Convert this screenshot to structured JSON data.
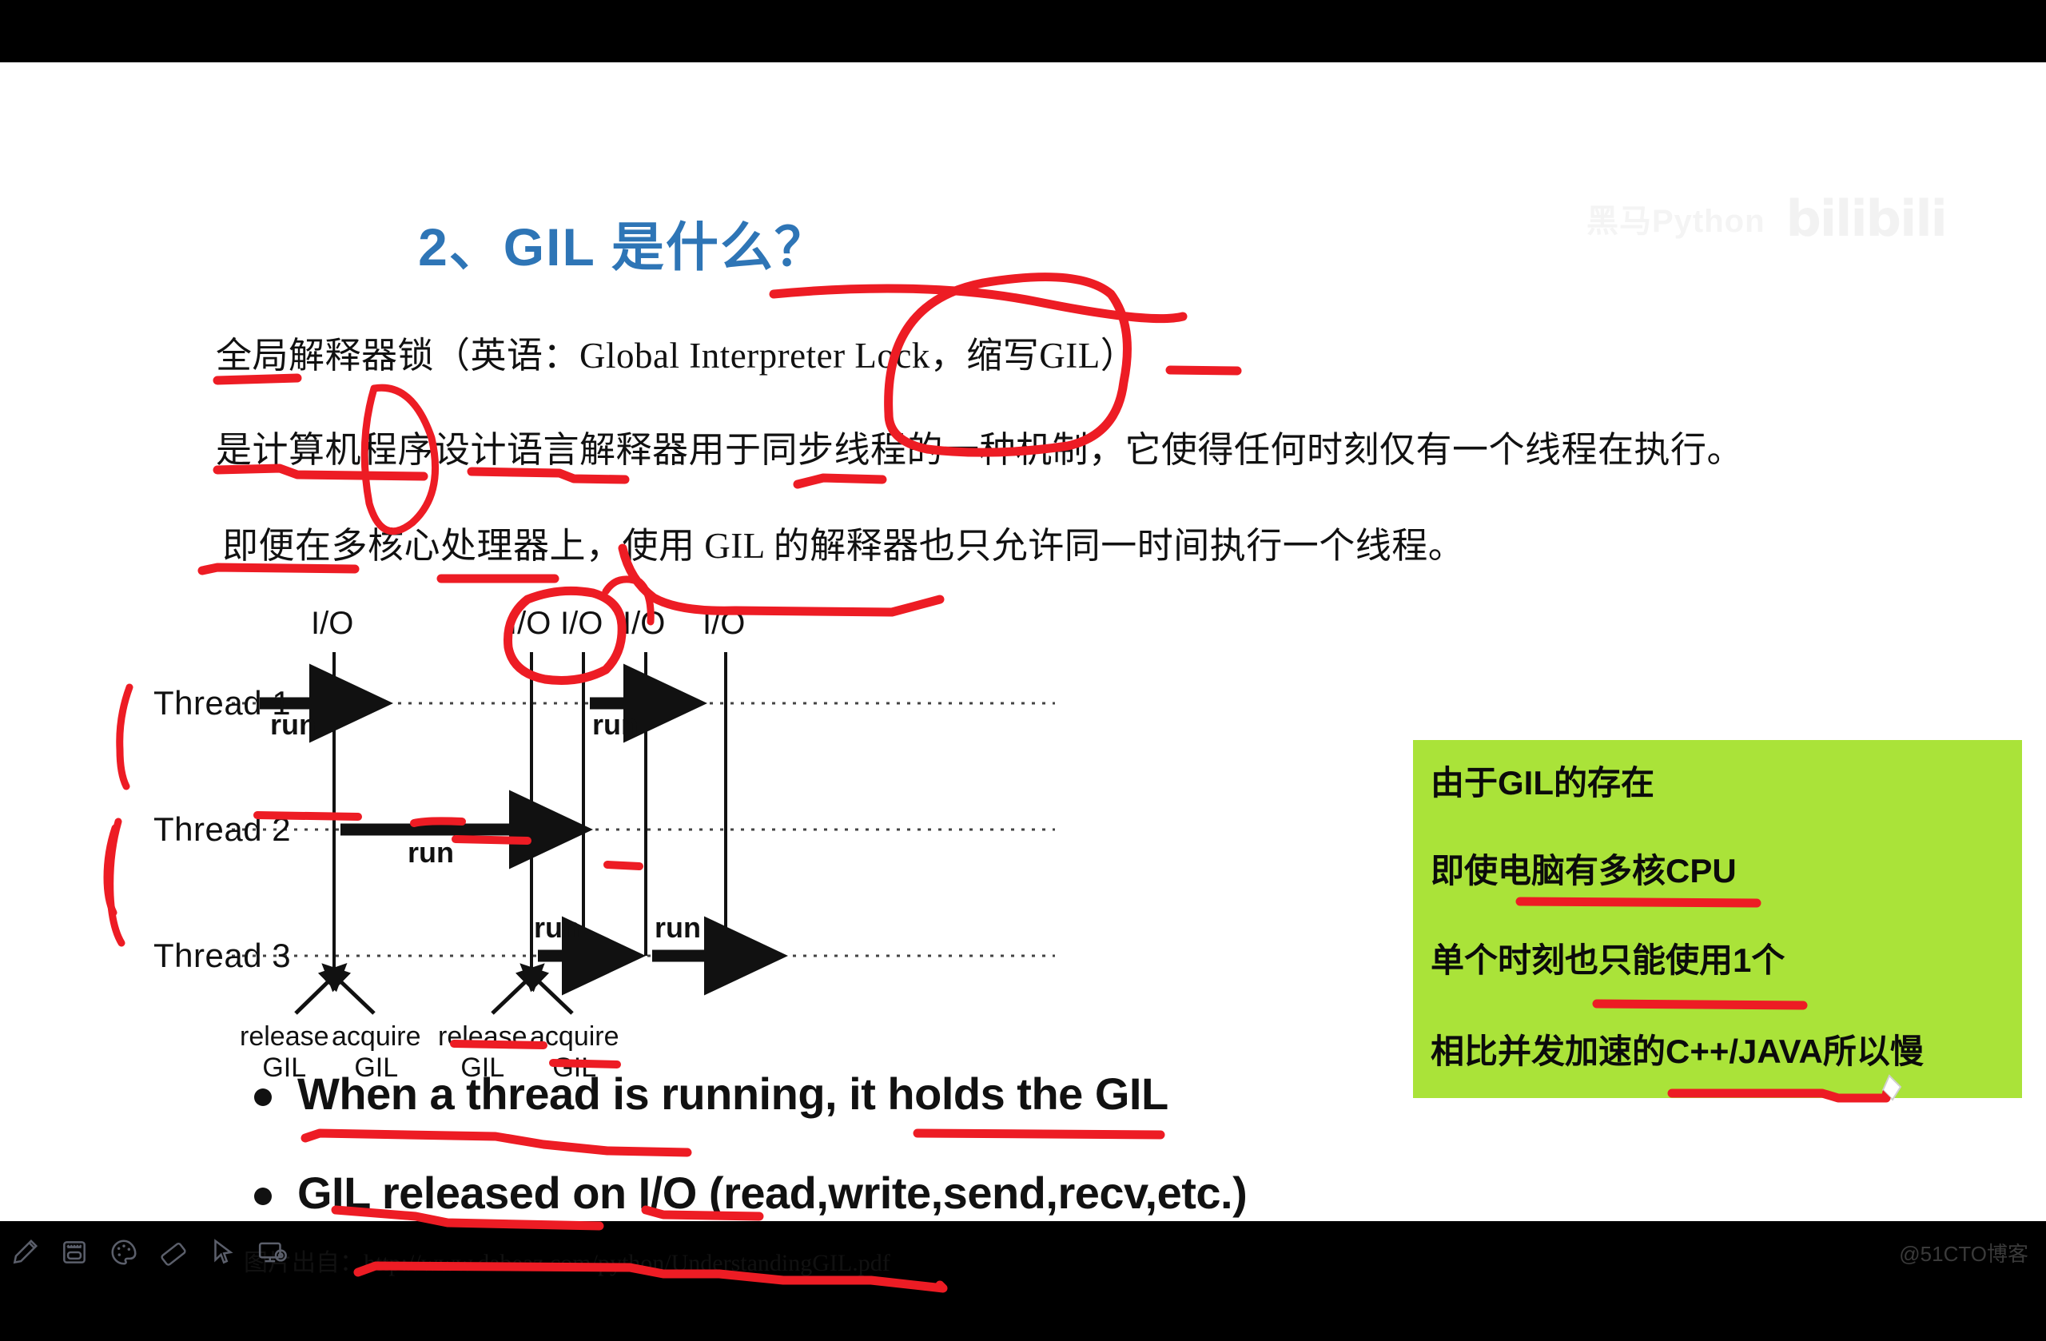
{
  "slide": {
    "title": "2、GIL 是什么？",
    "title_color": "#2E75B6",
    "paragraphs": [
      "全局解释器锁（英语：Global Interpreter Lock，缩写GIL）",
      "是计算机程序设计语言解释器用于同步线程的一种机制，它使得任何时刻仅有一个线程在执行。",
      "即便在多核心处理器上，使用 GIL 的解释器也只允许同一时间执行一个线程。"
    ],
    "bullets": [
      "When a thread is running, it holds the GIL",
      "GIL released on I/O (read,write,send,recv,etc.)"
    ],
    "source_line": "图片出自：http://www.dabeaz.com/python/UnderstandingGIL.pdf"
  },
  "diagram": {
    "thread_labels": [
      "Thread 1",
      "Thread 2",
      "Thread 3"
    ],
    "io_labels": [
      "I/O",
      "I/O",
      "I/O",
      "I/O",
      "I/O"
    ],
    "run_labels": [
      "run",
      "run",
      "run",
      "run",
      "run"
    ],
    "gil_events": [
      {
        "action": "release",
        "resource": "GIL"
      },
      {
        "action": "acquire",
        "resource": "GIL"
      },
      {
        "action": "release",
        "resource": "GIL"
      },
      {
        "action": "acquire",
        "resource": "GIL"
      }
    ]
  },
  "callout": {
    "bg_color": "#AAE339",
    "lines": [
      "由于GIL的存在",
      "即使电脑有多核CPU",
      "单个时刻也只能使用1个",
      "相比并发加速的C++/JAVA所以慢"
    ]
  },
  "watermark": {
    "text": "黑马Python",
    "logo": "bilibili",
    "corner": "@51CTO博客"
  },
  "toolbar": {
    "tools": [
      {
        "name": "pen-tool",
        "label": "画笔"
      },
      {
        "name": "shape-tool",
        "label": "形状"
      },
      {
        "name": "palette-tool",
        "label": "颜色"
      },
      {
        "name": "eraser-tool",
        "label": "橡皮"
      },
      {
        "name": "cursor-tool",
        "label": "选择"
      },
      {
        "name": "record-tool",
        "label": "录制"
      }
    ]
  },
  "annotations": {
    "ink_color": "#ED1C24"
  }
}
